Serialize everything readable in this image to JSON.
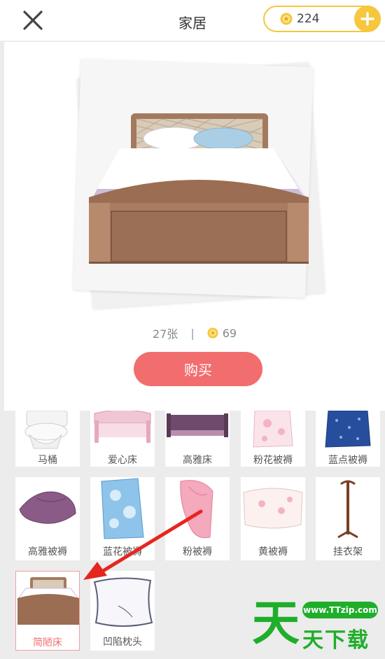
{
  "header": {
    "title": "家居",
    "coins": "224"
  },
  "detail": {
    "item_name": "简陋床",
    "count": "27张",
    "separator": "|",
    "price": "69",
    "buy_label": "购买"
  },
  "items": [
    {
      "label": "马桶",
      "icon": "toilet"
    },
    {
      "label": "爱心床",
      "icon": "pink-bed"
    },
    {
      "label": "高雅床",
      "icon": "purple-bed"
    },
    {
      "label": "粉花被褥",
      "icon": "floral-quilt"
    },
    {
      "label": "蓝点被褥",
      "icon": "blue-dot-quilt"
    },
    {
      "label": "高雅被褥",
      "icon": "purple-quilt"
    },
    {
      "label": "蓝花被褥",
      "icon": "blue-floral-quilt"
    },
    {
      "label": "粉被褥",
      "icon": "pink-quilt"
    },
    {
      "label": "黄被褥",
      "icon": "yellow-quilt"
    },
    {
      "label": "挂衣架",
      "icon": "coat-rack"
    },
    {
      "label": "简陋床",
      "icon": "simple-bed",
      "selected": true
    },
    {
      "label": "凹陷枕头",
      "icon": "pillow"
    }
  ],
  "watermark": {
    "url": "www.TTzip.com",
    "text": "天下载",
    "logo": "天"
  },
  "colors": {
    "accent": "#f26d6d",
    "coin": "#f6c63d",
    "watermark": "#1fae2a"
  }
}
